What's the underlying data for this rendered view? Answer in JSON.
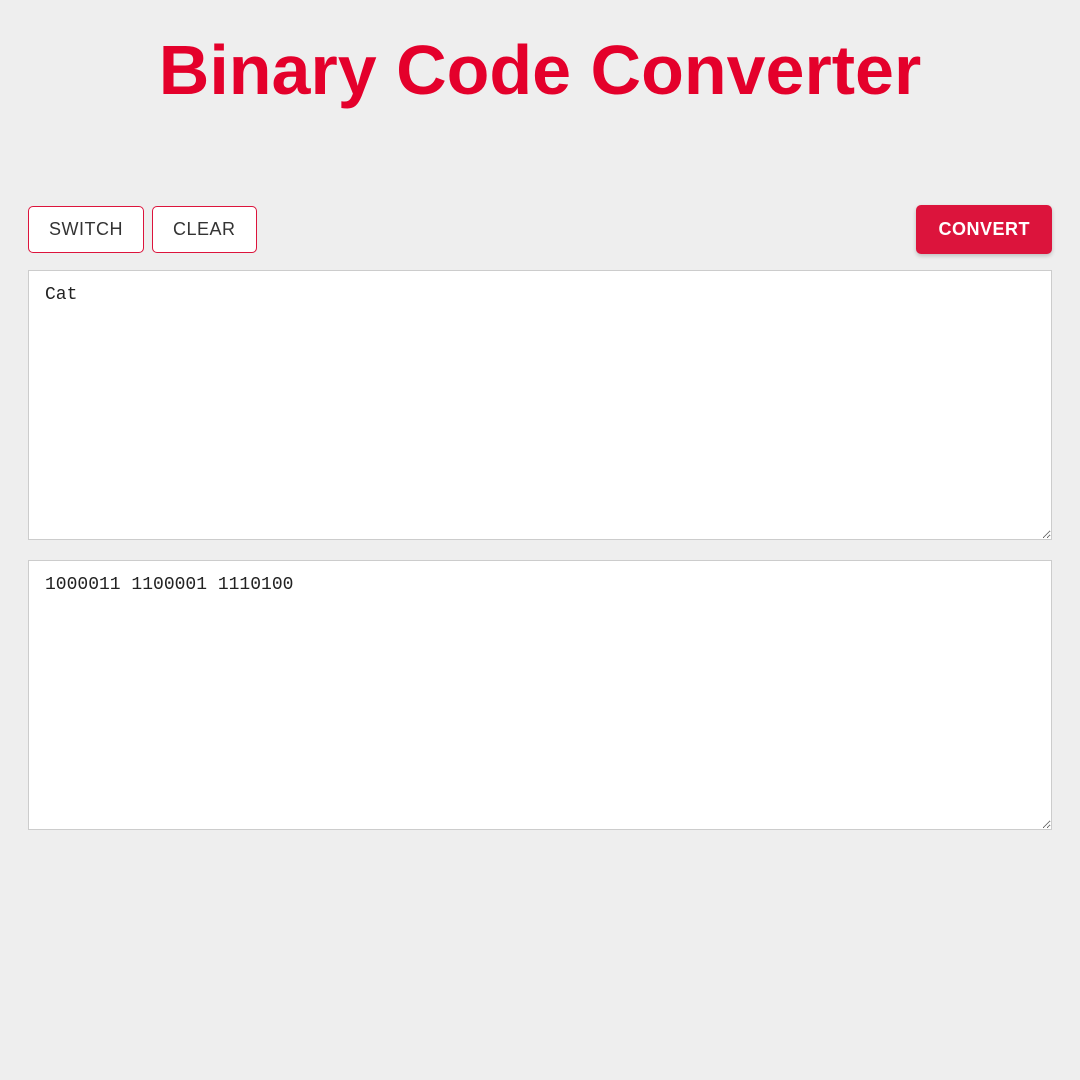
{
  "header": {
    "title": "Binary Code Converter"
  },
  "toolbar": {
    "switch_label": "SWITCH",
    "clear_label": "CLEAR",
    "convert_label": "CONVERT"
  },
  "input_area": {
    "value": "Cat"
  },
  "output_area": {
    "value": "1000011 1100001 1110100"
  }
}
